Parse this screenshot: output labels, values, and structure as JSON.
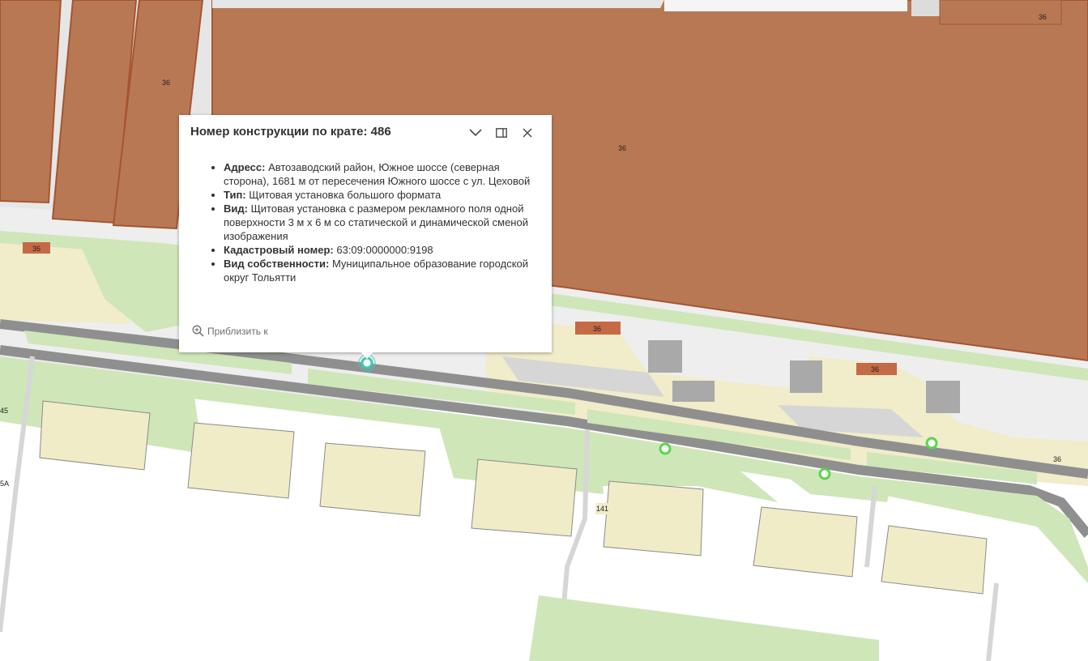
{
  "map": {
    "labels": [
      "36",
      "36",
      "36",
      "36",
      "36",
      "36",
      "36",
      "141",
      "45",
      "5А"
    ],
    "colors": {
      "building_brown": "#b97854",
      "building_edge": "#a5552f",
      "lot_yellow": "#f0ecc8",
      "green": "#cfe6b9",
      "road": "#8f8f8f",
      "sand": "#f1ecc9",
      "paved": "#d6d6d6",
      "point_green": "#5ad64a",
      "selected_point": "#3ec9b8"
    }
  },
  "popup": {
    "title": "Номер конструкции по крате: 486",
    "fields": [
      {
        "label": "Адресс:",
        "value": "Автозаводский район, Южное шоссе (северная сторона), 1681 м от пересечения Южного шоссе с ул. Цеховой"
      },
      {
        "label": "Тип:",
        "value": "Щитовая установка большого формата"
      },
      {
        "label": "Вид:",
        "value": "Щитовая установка с размером рекламного поля одной поверхности 3 м х 6 м со статической и динамической сменой изображения"
      },
      {
        "label": "Кадастровый номер:",
        "value": "63:09:0000000:9198"
      },
      {
        "label": "Вид собственности:",
        "value": "Муниципальное образование городской округ Тольятти"
      }
    ],
    "zoom_label": "Приблизить к",
    "icons": {
      "collapse": "chevron-down-icon",
      "dock": "dock-icon",
      "close": "close-icon",
      "zoom": "zoom-in-icon"
    }
  }
}
